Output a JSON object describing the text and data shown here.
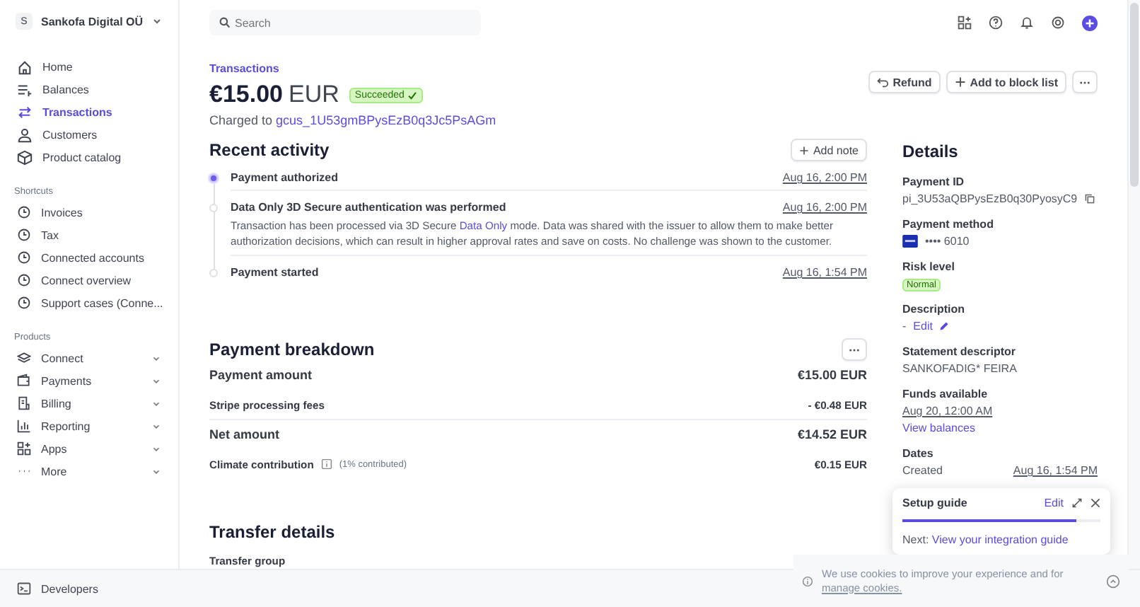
{
  "account": {
    "initial": "S",
    "name": "Sankofa Digital OÜ"
  },
  "sidebar": {
    "items": [
      {
        "label": "Home",
        "selected": false
      },
      {
        "label": "Balances",
        "selected": false
      },
      {
        "label": "Transactions",
        "selected": true
      },
      {
        "label": "Customers",
        "selected": false
      },
      {
        "label": "Product catalog",
        "selected": false
      }
    ],
    "shortcuts": {
      "title": "Shortcuts",
      "items": [
        "Invoices",
        "Tax",
        "Connected accounts",
        "Connect overview",
        "Support cases (Conne..."
      ]
    },
    "products": {
      "title": "Products",
      "items": [
        "Connect",
        "Payments",
        "Billing",
        "Reporting",
        "Apps",
        "More"
      ]
    },
    "footer": "Developers"
  },
  "search": {
    "placeholder": "Search"
  },
  "header": {
    "breadcrumb": "Transactions",
    "amount": "€15.00",
    "currency": "EUR",
    "status": "Succeeded",
    "charged_prefix": "Charged to",
    "customer": "gcus_1U53gmBPysEzB0q3Jc5PsAGm",
    "actions": [
      "Refund",
      "Add to block list"
    ]
  },
  "activity": {
    "title": "Recent activity",
    "add_note": "Add note",
    "events": [
      {
        "title": "Payment authorized",
        "time": "Aug 16, 2:00 PM",
        "active": true
      },
      {
        "title": "Data Only 3D Secure authentication was performed",
        "time": "Aug 16, 2:00 PM",
        "active": false,
        "description": {
          "before": "Transaction has been processed via 3D Secure",
          "link": "Data Only",
          "after": "mode. Data was shared with the issuer to allow them to make better authorization decisions, which can result in higher approval rates and save on costs. No challenge was shown to the customer."
        }
      },
      {
        "title": "Payment started",
        "time": "Aug 16, 1:54 PM",
        "active": false
      }
    ]
  },
  "breakdown": {
    "title": "Payment breakdown",
    "rows": [
      {
        "kind": "major",
        "label": "Payment amount",
        "value": "€15.00 EUR"
      },
      {
        "kind": "minor",
        "label": "Stripe processing fees",
        "value": "- €0.48 EUR"
      },
      {
        "kind": "major",
        "label": "Net amount",
        "value": "€14.52 EUR"
      },
      {
        "kind": "info",
        "label": "Climate contribution",
        "note": "(1% contributed)",
        "value": "€0.15 EUR"
      }
    ]
  },
  "transfer": {
    "title": "Transfer details",
    "rows": [
      "Transfer group"
    ]
  },
  "details": {
    "title": "Details",
    "payment_id_label": "Payment ID",
    "payment_id": "pi_3U53aQBPysEzB0q30PyosyC9",
    "method_label": "Payment method",
    "card": "•••• 6010",
    "risk_label": "Risk level",
    "risk": "Normal",
    "description_label": "Description",
    "description": "-",
    "edit": "Edit",
    "descriptor_label": "Statement descriptor",
    "descriptor": "SANKOFADIG* FEIRA",
    "funds_label": "Funds available",
    "funds_date": "Aug 20, 12:00 AM",
    "view_balances": "View balances",
    "dates_label": "Dates",
    "created_label": "Created",
    "created": "Aug 16, 1:54 PM"
  },
  "setup_guide": {
    "title": "Setup guide",
    "edit": "Edit",
    "level": 0.88,
    "next_prefix": "Next:",
    "next_link": "View your integration guide"
  },
  "cookie": {
    "text": "We use cookies to improve your experience and for",
    "link_text": "manage cookies."
  }
}
